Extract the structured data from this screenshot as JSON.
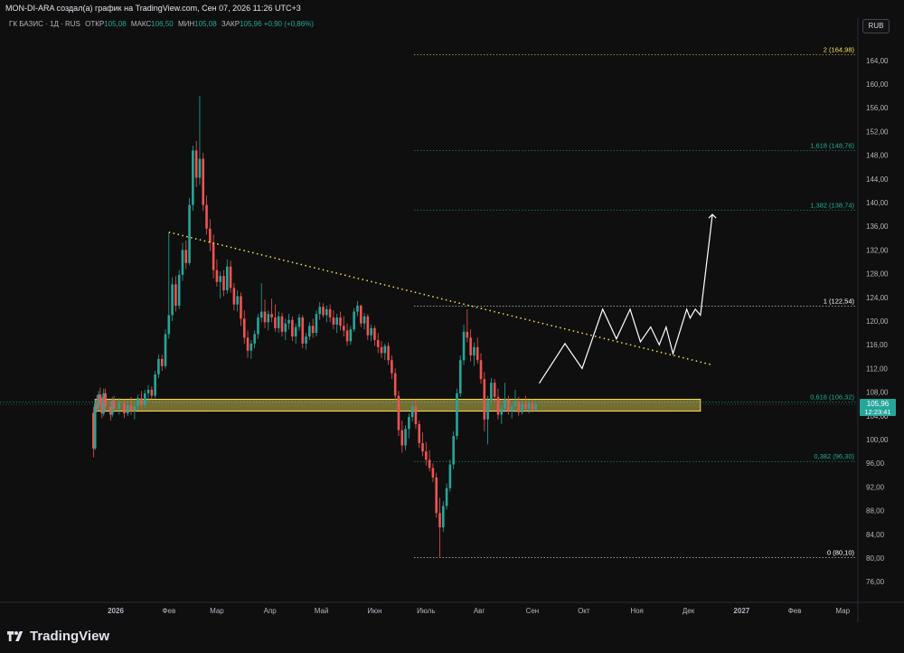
{
  "caption": "MON-DI-ARA создал(а) график на TradingView.com, Сен 07, 2026 11:26 UTC+3",
  "legend": {
    "symbol": "ГК БАЗИС · 1Д · RUS",
    "open_label": "ОТКР",
    "open": "105,08",
    "high_label": "МАКС",
    "high": "106,50",
    "low_label": "МИН",
    "low": "105,08",
    "close_label": "ЗАКР",
    "close": "105,96",
    "change": "+0,90 (+0,86%)"
  },
  "currency": "RUB",
  "logo": "TradingView",
  "colors": {
    "up": "#26a69a",
    "down": "#ef5350",
    "zone": "#f5e05a",
    "trend": "#f5e05a",
    "projection": "#ffffff",
    "fib": "#22ab94"
  },
  "chart_data": {
    "type": "candlestick",
    "y_axis": {
      "range": [
        72,
        169
      ],
      "ticks": [
        "76,00",
        "80,00",
        "84,00",
        "88,00",
        "92,00",
        "96,00",
        "100,00",
        "104,00",
        "108,00",
        "112,00",
        "116,00",
        "120,00",
        "124,00",
        "128,00",
        "132,00",
        "136,00",
        "140,00",
        "144,00",
        "148,00",
        "152,00",
        "156,00",
        "160,00",
        "164,00"
      ],
      "tick_values": [
        76,
        80,
        84,
        88,
        92,
        96,
        100,
        104,
        108,
        112,
        116,
        120,
        124,
        128,
        132,
        136,
        140,
        144,
        148,
        152,
        156,
        160,
        164
      ]
    },
    "x_axis": {
      "labels": [
        "2026",
        "Фев",
        "Мар",
        "Апр",
        "Май",
        "Июн",
        "Июль",
        "Авг",
        "Сен",
        "Окт",
        "Ноя",
        "Дек",
        "2027",
        "Фев",
        "Мар"
      ],
      "dates": [
        "2026-01-01",
        "2026-02-01",
        "2026-03-01",
        "2026-04-01",
        "2026-05-01",
        "2026-06-01",
        "2026-07-01",
        "2026-08-01",
        "2026-09-01",
        "2026-10-01",
        "2026-11-01",
        "2026-12-01",
        "2027-01-01",
        "2027-02-01",
        "2027-03-01"
      ]
    },
    "last_price": {
      "value": "105,96",
      "countdown": "12:23:41"
    },
    "fib_levels": [
      {
        "label": "2 (164,98)",
        "value": 164.98,
        "color": "#f5e05a"
      },
      {
        "label": "1,618 (148,76)",
        "value": 148.76,
        "color": "#22ab94"
      },
      {
        "label": "1,382 (138,74)",
        "value": 138.74,
        "color": "#22ab94"
      },
      {
        "label": "1 (122,54)",
        "value": 122.54,
        "color": "#ffffff"
      },
      {
        "label": "0,618 (106,32)",
        "value": 106.32,
        "color": "#22ab94"
      },
      {
        "label": "0,382 (96,30)",
        "value": 96.3,
        "color": "#22ab94"
      },
      {
        "label": "0 (80,10)",
        "value": 80.1,
        "color": "#ffffff"
      }
    ],
    "support_zone": {
      "from_date": "2025-12-20",
      "to_date": "2026-12-08",
      "low": 104.8,
      "high": 106.8
    },
    "trendline": {
      "points": [
        [
          "2026-02-01",
          135.0
        ],
        [
          "2026-12-15",
          112.6
        ]
      ]
    },
    "projection": {
      "points": [
        [
          "2026-09-05",
          109.5
        ],
        [
          "2026-09-20",
          116.2
        ],
        [
          "2026-09-30",
          112
        ],
        [
          "2026-10-12",
          122
        ],
        [
          "2026-10-20",
          117
        ],
        [
          "2026-10-28",
          122
        ],
        [
          "2026-11-03",
          116.5
        ],
        [
          "2026-11-09",
          119
        ],
        [
          "2026-11-14",
          116
        ],
        [
          "2026-11-18",
          119
        ],
        [
          "2026-11-22",
          114.5
        ],
        [
          "2026-11-30",
          122
        ],
        [
          "2026-12-02",
          120.5
        ],
        [
          "2026-12-05",
          122
        ],
        [
          "2026-12-08",
          121
        ],
        [
          "2026-12-15",
          138
        ]
      ]
    },
    "candles_ohlc": [
      [
        "2025-12-19",
        104.5,
        105.5,
        97.0,
        98.5
      ],
      [
        "2025-12-20",
        98.5,
        106.8,
        98.2,
        106.0
      ],
      [
        "2025-12-21",
        106,
        107.5,
        104.6,
        105.2
      ],
      [
        "2025-12-22",
        105.2,
        108.2,
        104.8,
        107.6
      ],
      [
        "2025-12-23",
        107.6,
        108.8,
        105.8,
        106.4
      ],
      [
        "2025-12-24",
        106.4,
        107.2,
        103.6,
        104.4
      ],
      [
        "2025-12-25",
        104.4,
        108.6,
        104.0,
        107.8
      ],
      [
        "2025-12-26",
        107.8,
        108.6,
        104.8,
        105.6
      ],
      [
        "2025-12-29",
        105.6,
        106.4,
        103.2,
        104.2
      ],
      [
        "2025-12-30",
        104.2,
        107.2,
        103.8,
        106.6
      ],
      [
        "2025-12-31",
        106.6,
        107.4,
        104.6,
        105.2
      ],
      [
        "2026-01-03",
        105.2,
        107.0,
        104.2,
        106.2
      ],
      [
        "2026-01-06",
        106.2,
        106.8,
        103.6,
        104.4
      ],
      [
        "2026-01-08",
        104.4,
        106.6,
        104.0,
        105.8
      ],
      [
        "2026-01-10",
        105.8,
        107.2,
        104.2,
        104.8
      ],
      [
        "2026-01-12",
        104.8,
        106.2,
        103.4,
        105.6
      ],
      [
        "2026-01-14",
        105.6,
        107.6,
        105.0,
        107.0
      ],
      [
        "2026-01-16",
        107.0,
        108.2,
        105.2,
        105.8
      ],
      [
        "2026-01-18",
        105.8,
        108.4,
        105.4,
        107.8
      ],
      [
        "2026-01-20",
        107.8,
        109.2,
        106.4,
        108.4
      ],
      [
        "2026-01-22",
        108.4,
        109.0,
        106.8,
        107.4
      ],
      [
        "2026-01-24",
        107.4,
        111.6,
        107.0,
        111.0
      ],
      [
        "2026-01-26",
        111.0,
        114.4,
        110.4,
        113.6
      ],
      [
        "2026-01-28",
        113.6,
        114.4,
        111.6,
        112.4
      ],
      [
        "2026-01-30",
        112.4,
        118.6,
        112.0,
        117.8
      ],
      [
        "2026-02-01",
        117.8,
        135.0,
        117.0,
        121.0
      ],
      [
        "2026-02-03",
        121.0,
        127.4,
        120.0,
        126.2
      ],
      [
        "2026-02-05",
        126.2,
        127.6,
        121.6,
        122.6
      ],
      [
        "2026-02-07",
        122.6,
        128.6,
        122.0,
        127.8
      ],
      [
        "2026-02-09",
        127.8,
        133.2,
        126.8,
        132.0
      ],
      [
        "2026-02-11",
        132.0,
        133.6,
        128.8,
        129.8
      ],
      [
        "2026-02-13",
        129.8,
        140.8,
        129.4,
        139.6
      ],
      [
        "2026-02-15",
        139.6,
        149.6,
        138.6,
        148.8
      ],
      [
        "2026-02-17",
        148.8,
        150.4,
        142.6,
        144.2
      ],
      [
        "2026-02-19",
        144.2,
        158.0,
        143.0,
        147.4
      ],
      [
        "2026-02-21",
        147.4,
        148.4,
        138.6,
        139.6
      ],
      [
        "2026-02-23",
        139.6,
        141.2,
        134.6,
        135.6
      ],
      [
        "2026-02-25",
        135.6,
        137.2,
        131.8,
        133.2
      ],
      [
        "2026-02-27",
        133.2,
        134.6,
        127.2,
        128.6
      ],
      [
        "2026-03-01",
        128.6,
        130.4,
        125.8,
        126.6
      ],
      [
        "2026-03-03",
        126.6,
        128.4,
        123.8,
        127.6
      ],
      [
        "2026-03-05",
        127.6,
        128.6,
        124.2,
        125.2
      ],
      [
        "2026-03-07",
        125.2,
        130.4,
        124.6,
        129.2
      ],
      [
        "2026-03-09",
        129.2,
        130.2,
        124.8,
        125.6
      ],
      [
        "2026-03-11",
        125.6,
        126.4,
        121.8,
        122.8
      ],
      [
        "2026-03-13",
        122.8,
        125.2,
        121.6,
        124.2
      ],
      [
        "2026-03-15",
        124.2,
        124.8,
        119.2,
        120.4
      ],
      [
        "2026-03-17",
        120.4,
        121.8,
        116.2,
        117.2
      ],
      [
        "2026-03-19",
        117.2,
        118.4,
        113.8,
        115.0
      ],
      [
        "2026-03-21",
        115.0,
        116.8,
        113.6,
        116.2
      ],
      [
        "2026-03-23",
        116.2,
        118.4,
        115.4,
        117.8
      ],
      [
        "2026-03-25",
        117.8,
        121.2,
        117.0,
        120.6
      ],
      [
        "2026-03-27",
        120.6,
        126.4,
        119.8,
        121.6
      ],
      [
        "2026-03-29",
        121.6,
        123.6,
        118.8,
        119.8
      ],
      [
        "2026-03-31",
        119.8,
        121.8,
        118.4,
        121.2
      ],
      [
        "2026-04-02",
        121.2,
        123.8,
        119.8,
        120.6
      ],
      [
        "2026-04-04",
        120.6,
        122.8,
        118.2,
        118.8
      ],
      [
        "2026-04-06",
        118.8,
        121.6,
        118.0,
        120.8
      ],
      [
        "2026-04-08",
        120.8,
        121.4,
        117.4,
        118.2
      ],
      [
        "2026-04-10",
        118.2,
        120.4,
        116.8,
        119.6
      ],
      [
        "2026-04-12",
        119.6,
        121.2,
        118.6,
        120.2
      ],
      [
        "2026-04-14",
        120.2,
        120.8,
        116.6,
        117.4
      ],
      [
        "2026-04-16",
        117.4,
        119.6,
        116.2,
        119.0
      ],
      [
        "2026-04-18",
        119.0,
        121.2,
        118.4,
        120.6
      ],
      [
        "2026-04-20",
        120.6,
        121.0,
        115.4,
        116.2
      ],
      [
        "2026-04-22",
        116.2,
        118.0,
        115.2,
        117.4
      ],
      [
        "2026-04-24",
        117.4,
        119.8,
        116.8,
        119.2
      ],
      [
        "2026-04-26",
        119.2,
        120.4,
        117.2,
        118.0
      ],
      [
        "2026-04-28",
        118.0,
        121.8,
        117.4,
        121.2
      ],
      [
        "2026-04-30",
        121.2,
        123.2,
        120.2,
        122.4
      ],
      [
        "2026-05-02",
        122.4,
        123.0,
        120.6,
        121.0
      ],
      [
        "2026-05-04",
        121.0,
        122.6,
        119.8,
        122.0
      ],
      [
        "2026-05-06",
        122.0,
        122.8,
        119.8,
        120.6
      ],
      [
        "2026-05-08",
        120.6,
        121.8,
        118.6,
        119.4
      ],
      [
        "2026-05-10",
        119.4,
        121.2,
        118.0,
        120.6
      ],
      [
        "2026-05-12",
        120.6,
        121.6,
        118.4,
        119.2
      ],
      [
        "2026-05-14",
        119.2,
        120.8,
        117.4,
        118.4
      ],
      [
        "2026-05-16",
        118.4,
        119.6,
        115.8,
        116.6
      ],
      [
        "2026-05-18",
        116.6,
        119.2,
        116.0,
        118.6
      ],
      [
        "2026-05-20",
        118.6,
        122.2,
        118.2,
        121.6
      ],
      [
        "2026-05-22",
        121.6,
        123.4,
        120.8,
        122.6
      ],
      [
        "2026-05-24",
        122.6,
        122.8,
        119.0,
        119.6
      ],
      [
        "2026-05-26",
        119.6,
        121.4,
        118.6,
        120.8
      ],
      [
        "2026-05-28",
        120.8,
        121.2,
        116.8,
        117.6
      ],
      [
        "2026-05-30",
        117.6,
        119.4,
        116.6,
        118.8
      ],
      [
        "2026-06-01",
        118.8,
        119.2,
        115.8,
        116.8
      ],
      [
        "2026-06-03",
        116.8,
        118.0,
        114.6,
        115.6
      ],
      [
        "2026-06-05",
        115.6,
        116.6,
        113.8,
        114.6
      ],
      [
        "2026-06-07",
        114.6,
        116.2,
        113.4,
        115.8
      ],
      [
        "2026-06-09",
        115.8,
        116.4,
        112.6,
        113.4
      ],
      [
        "2026-06-11",
        113.4,
        114.2,
        110.2,
        111.2
      ],
      [
        "2026-06-13",
        111.2,
        112.0,
        106.6,
        107.4
      ],
      [
        "2026-06-15",
        107.4,
        108.2,
        100.6,
        101.6
      ],
      [
        "2026-06-17",
        101.6,
        103.2,
        97.8,
        99.0
      ],
      [
        "2026-06-19",
        99.0,
        102.4,
        98.2,
        101.8
      ],
      [
        "2026-06-21",
        101.8,
        104.4,
        100.2,
        103.8
      ],
      [
        "2026-06-23",
        103.8,
        106.4,
        103.0,
        105.6
      ],
      [
        "2026-06-25",
        105.6,
        106.8,
        101.8,
        102.6
      ],
      [
        "2026-06-27",
        102.6,
        103.2,
        98.6,
        99.4
      ],
      [
        "2026-06-29",
        99.4,
        101.2,
        97.2,
        98.0
      ],
      [
        "2026-07-01",
        98.0,
        99.6,
        95.6,
        96.6
      ],
      [
        "2026-07-03",
        96.6,
        98.2,
        94.6,
        95.2
      ],
      [
        "2026-07-05",
        95.2,
        96.0,
        92.8,
        93.6
      ],
      [
        "2026-07-07",
        93.6,
        94.4,
        86.8,
        87.6
      ],
      [
        "2026-07-09",
        87.6,
        90.2,
        80.1,
        85.2
      ],
      [
        "2026-07-11",
        85.2,
        89.6,
        84.4,
        88.8
      ],
      [
        "2026-07-13",
        88.8,
        92.6,
        88.2,
        91.8
      ],
      [
        "2026-07-15",
        91.8,
        96.6,
        91.2,
        95.8
      ],
      [
        "2026-07-17",
        95.8,
        101.4,
        95.0,
        100.6
      ],
      [
        "2026-07-19",
        100.6,
        108.6,
        100.0,
        107.8
      ],
      [
        "2026-07-21",
        107.8,
        114.2,
        107.2,
        113.4
      ],
      [
        "2026-07-23",
        113.4,
        119.4,
        112.6,
        118.2
      ],
      [
        "2026-07-25",
        118.2,
        122.0,
        116.4,
        117.2
      ],
      [
        "2026-07-27",
        117.2,
        118.6,
        113.2,
        114.2
      ],
      [
        "2026-07-29",
        114.2,
        116.4,
        112.4,
        115.6
      ],
      [
        "2026-07-31",
        115.6,
        117.2,
        112.8,
        113.4
      ],
      [
        "2026-08-02",
        113.4,
        114.6,
        109.4,
        110.2
      ],
      [
        "2026-08-04",
        110.2,
        111.4,
        101.4,
        103.4
      ],
      [
        "2026-08-06",
        103.4,
        107.4,
        99.2,
        106.6
      ],
      [
        "2026-08-08",
        106.6,
        110.4,
        105.8,
        109.6
      ],
      [
        "2026-08-10",
        109.6,
        110.2,
        106.4,
        107.2
      ],
      [
        "2026-08-12",
        107.2,
        108.6,
        103.4,
        104.2
      ],
      [
        "2026-08-14",
        104.2,
        105.8,
        102.6,
        105.2
      ],
      [
        "2026-08-16",
        105.2,
        109.6,
        104.6,
        106.8
      ],
      [
        "2026-08-18",
        106.8,
        107.4,
        104.2,
        104.8
      ],
      [
        "2026-08-20",
        104.8,
        106.2,
        103.6,
        105.6
      ],
      [
        "2026-08-22",
        105.6,
        108.4,
        104.6,
        106.4
      ],
      [
        "2026-08-24",
        106.4,
        107.2,
        104.0,
        104.6
      ],
      [
        "2026-08-26",
        104.6,
        106.6,
        104.2,
        106.0
      ],
      [
        "2026-08-28",
        106.0,
        107.4,
        104.8,
        105.2
      ],
      [
        "2026-08-30",
        105.2,
        106.6,
        104.4,
        106.2
      ],
      [
        "2026-09-01",
        106.2,
        106.8,
        104.6,
        105.0
      ],
      [
        "2026-09-03",
        105.0,
        106.5,
        104.8,
        105.96
      ]
    ]
  }
}
